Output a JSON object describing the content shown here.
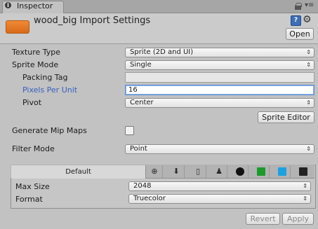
{
  "tab": {
    "label": "Inspector",
    "icon": "info-icon"
  },
  "header": {
    "title": "wood_big Import Settings",
    "open_label": "Open",
    "asset_color": "#e8792a"
  },
  "fields": {
    "texture_type": {
      "label": "Texture Type",
      "value": "Sprite (2D and UI)"
    },
    "sprite_mode": {
      "label": "Sprite Mode",
      "value": "Single"
    },
    "packing_tag": {
      "label": "Packing Tag",
      "value": ""
    },
    "pixels_per_unit": {
      "label": "Pixels Per Unit",
      "value": "16"
    },
    "pivot": {
      "label": "Pivot",
      "value": "Center"
    },
    "sprite_editor_label": "Sprite Editor",
    "generate_mip_maps": {
      "label": "Generate Mip Maps",
      "checked": false
    },
    "filter_mode": {
      "label": "Filter Mode",
      "value": "Point"
    }
  },
  "platform": {
    "default_tab": "Default",
    "tabs": [
      "globe-icon",
      "download-icon",
      "phone-icon",
      "android-icon",
      "blackberry-icon",
      "windows-store-icon",
      "windows-phone-icon",
      "html5-icon"
    ],
    "max_size": {
      "label": "Max Size",
      "value": "2048"
    },
    "format": {
      "label": "Format",
      "value": "Truecolor"
    }
  },
  "buttons": {
    "revert": "Revert",
    "apply": "Apply"
  },
  "colors": {
    "highlight_label": "#3760c0",
    "focus_border": "#5b8fd6"
  }
}
